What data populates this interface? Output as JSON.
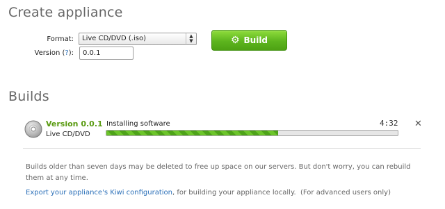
{
  "create": {
    "title": "Create appliance",
    "format_label": "Format:",
    "format_value": "Live CD/DVD (.iso)",
    "version_label_pre": "Version (",
    "version_help": "?",
    "version_label_post": "):",
    "version_value": "0.0.1",
    "build_button": "Build",
    "build_button_icon": "gear-icon"
  },
  "builds": {
    "title": "Builds",
    "item": {
      "icon": "disc-icon",
      "version": "Version 0.0.1",
      "type": "Live CD/DVD",
      "status": "Installing software",
      "time": "4:32",
      "progress": 0.59,
      "close_icon": "close-icon"
    },
    "notice": "Builds older than seven days may be deleted to free up space on our servers. But don't worry, you can rebuild them at any time.",
    "export_link": "Export your appliance's Kiwi configuration",
    "export_rest": ", for building your appliance locally.",
    "export_note": "(For advanced users only)"
  },
  "colors": {
    "accent_green": "#5a9b12",
    "link_blue": "#2a6fb8"
  }
}
